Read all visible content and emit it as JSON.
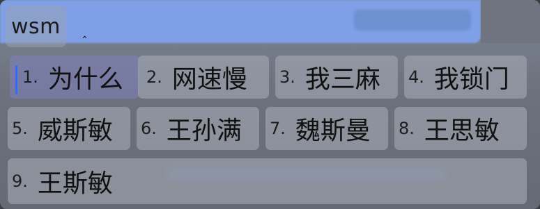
{
  "preedit": {
    "text": "wsm",
    "caret_symbol": "ˆ"
  },
  "candidates": [
    {
      "index": "1.",
      "text": "为什么",
      "selected": true
    },
    {
      "index": "2.",
      "text": "网速慢",
      "selected": false
    },
    {
      "index": "3.",
      "text": "我三麻",
      "selected": false
    },
    {
      "index": "4.",
      "text": "我锁门",
      "selected": false
    },
    {
      "index": "5.",
      "text": "威斯敏",
      "selected": false
    },
    {
      "index": "6.",
      "text": "王孙满",
      "selected": false
    },
    {
      "index": "7.",
      "text": "魏斯曼",
      "selected": false
    },
    {
      "index": "8.",
      "text": "王思敏",
      "selected": false
    },
    {
      "index": "9.",
      "text": "王斯敏",
      "selected": false
    }
  ],
  "colors": {
    "selection_accent": "#2f6bff",
    "header_band": "#7fa0e6"
  }
}
